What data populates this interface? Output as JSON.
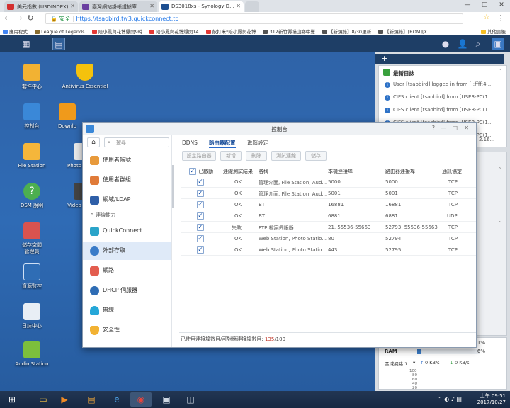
{
  "browser": {
    "tabs": [
      {
        "title": "美元指數 (USDINDEX) ...",
        "icon": "w-letter-icon",
        "color": "#d32f2f"
      },
      {
        "title": "臺灣網站掛帳證據庫",
        "icon": "purple-logo-icon",
        "color": "#6a3fa0"
      },
      {
        "title": "DS3018xs - Synology D...",
        "icon": "dsm-logo-icon",
        "color": "#1d4f91"
      }
    ],
    "window_controls": [
      "—",
      "□",
      "✕"
    ],
    "secure_label": "安全",
    "url": "https://tsaobird.tw3.quickconnect.to",
    "bookmarks": [
      {
        "label": "應用程式",
        "color": "#4285f4"
      },
      {
        "label": "League of Legends",
        "color": "#8a6d2f"
      },
      {
        "label": "陪小鳳與花博爆開9時",
        "color": "#e53935"
      },
      {
        "label": "陪小鳳與花博爆開14",
        "color": "#e53935"
      },
      {
        "label": "飲打米*陪小鳳與花博",
        "color": "#e53935"
      },
      {
        "label": "312新竹縣橫山鄉中豐",
        "color": "#333333"
      },
      {
        "label": "【新燒錄】8/30更新",
        "color": "#333333"
      },
      {
        "label": "【新燒錄】[ROM][X...",
        "color": "#333333"
      },
      {
        "label": "其他書籤",
        "color": "#f6bf26"
      }
    ]
  },
  "desktop": {
    "icons": [
      {
        "label": "套件中心",
        "name": "package-center-icon",
        "color": "#f2b233"
      },
      {
        "label": "控制台",
        "name": "control-panel-icon",
        "color": "#3a88d8"
      },
      {
        "label": "File Station",
        "name": "file-station-icon",
        "color": "#f5b63b"
      },
      {
        "label": "DSM 說明",
        "name": "dsm-help-icon",
        "color": "#4caf50"
      },
      {
        "label": "儲存空間\n管理員",
        "name": "storage-manager-icon",
        "color": "#d9534f"
      },
      {
        "label": "資源監控",
        "name": "resource-monitor-icon",
        "color": "#2f6db5"
      },
      {
        "label": "日誌中心",
        "name": "log-center-icon",
        "color": "#e8eef5"
      },
      {
        "label": "Audio Station",
        "name": "audio-station-icon",
        "color": "#7cbf3c"
      },
      {
        "label": "Antivirus Essential",
        "name": "antivirus-icon",
        "color": "#f4c20d"
      },
      {
        "label": "Downlo",
        "name": "download-station-icon",
        "color": "#f09a1b"
      },
      {
        "label": "Photo",
        "name": "photo-station-icon",
        "color": "#eaeaea"
      },
      {
        "label": "Video",
        "name": "video-station-icon",
        "color": "#444444"
      }
    ]
  },
  "widgets": {
    "log_title": "最新日誌",
    "logs": [
      "User [tsaobird] logged in from [::ffff:4...",
      "CIFS client [tsaobird] from [USER-PC(1...",
      "CIFS client [tsaobird] from [USER-PC(1...",
      "CIFS client [tsaobird] from [USER-PC(1...",
      "CIFS client [tsaobird] from [USER-PC(1..."
    ],
    "log_tail": "2.16...",
    "cpu_label": "",
    "cpu_pct": "1%",
    "ram_label": "RAM",
    "ram_pct": "6%",
    "ram_fill": 6,
    "net_label": "區域網路 1",
    "net_up": "0 KB/s",
    "net_down": "0 KB/s",
    "net_axis": [
      "100",
      "80",
      "60",
      "40",
      "20",
      "0"
    ]
  },
  "window": {
    "title": "控制台",
    "controls": [
      "?",
      "—",
      "□",
      "✕"
    ],
    "search_placeholder": "搜尋",
    "sidebar": [
      {
        "label": "使用者帳號",
        "icon": "user-icon",
        "color": "#e89a3c"
      },
      {
        "label": "使用者群組",
        "icon": "user-group-icon",
        "color": "#e07b39"
      },
      {
        "label": "網域/LDAP",
        "icon": "domain-ldap-icon",
        "color": "#2f5fa8"
      },
      {
        "label": "QuickConnect",
        "icon": "quickconnect-icon",
        "color": "#2aa4c9"
      },
      {
        "label": "外部存取",
        "icon": "external-access-icon",
        "color": "#3a7cc8"
      },
      {
        "label": "網路",
        "icon": "network-icon",
        "color": "#e35d4f"
      },
      {
        "label": "DHCP 伺服器",
        "icon": "dhcp-server-icon",
        "color": "#2f6db5"
      },
      {
        "label": "無線",
        "icon": "wireless-icon",
        "color": "#25a7d8"
      },
      {
        "label": "安全性",
        "icon": "security-icon",
        "color": "#f2b233"
      }
    ],
    "group_label": "連線能力",
    "tabs": [
      "DDNS",
      "路由器配置",
      "進階設定"
    ],
    "buttons": [
      "設定路由器",
      "新增",
      "刪除",
      "測試連線",
      "儲存"
    ],
    "columns": [
      "已啟動",
      "連線測試結果",
      "名稱",
      "本機連接埠",
      "路由器連接埠",
      "通訊協定"
    ],
    "rows": [
      {
        "result": "OK",
        "name": "管理介面, File Station, Aud...",
        "local": "5000",
        "router": "5000",
        "proto": "TCP"
      },
      {
        "result": "OK",
        "name": "管理介面, File Station, Aud...",
        "local": "5001",
        "router": "5001",
        "proto": "TCP"
      },
      {
        "result": "OK",
        "name": "BT",
        "local": "16881",
        "router": "16881",
        "proto": "TCP"
      },
      {
        "result": "OK",
        "name": "BT",
        "local": "6881",
        "router": "6881",
        "proto": "UDP"
      },
      {
        "result": "失敗",
        "name": "FTP 檔案伺服器",
        "local": "21, 55536-55663",
        "router": "52793, 55536-55663",
        "proto": "TCP"
      },
      {
        "result": "OK",
        "name": "Web Station, Photo Statio...",
        "local": "80",
        "router": "52794",
        "proto": "TCP"
      },
      {
        "result": "OK",
        "name": "Web Station, Photo Statio...",
        "local": "443",
        "router": "52795",
        "proto": "TCP"
      }
    ],
    "footer_text": "已使用連接埠數目/可對應連接埠數目:",
    "footer_used": "135",
    "footer_total": "/100"
  },
  "taskbar": {
    "time": "上午 09:51",
    "date": "2017/10/27"
  }
}
